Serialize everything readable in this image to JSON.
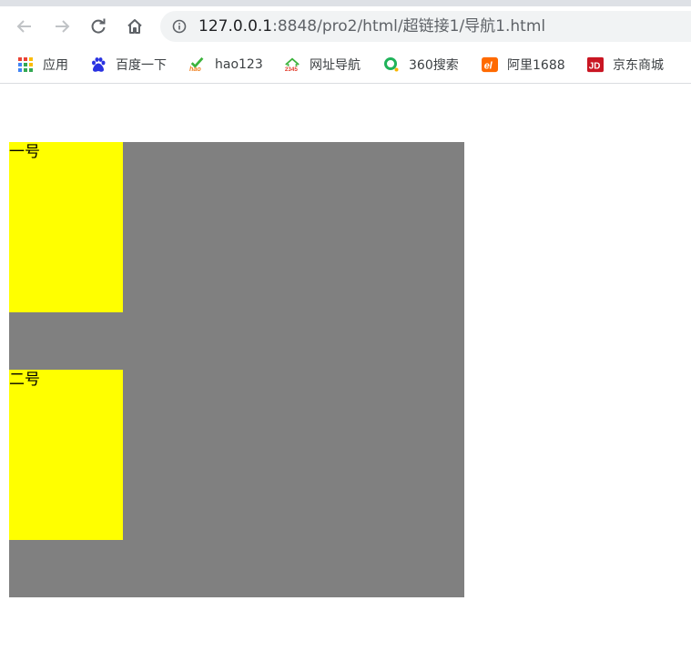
{
  "browser": {
    "url_host": "127.0.0.1",
    "url_rest": ":8848/pro2/html/超链接1/导航1.html"
  },
  "bookmarks": [
    {
      "label": "应用",
      "icon": "apps-grid-icon"
    },
    {
      "label": "百度一下",
      "icon": "baidu-paw-icon"
    },
    {
      "label": "hao123",
      "icon": "hao123-icon"
    },
    {
      "label": "网址导航",
      "icon": "2345-house-icon"
    },
    {
      "label": "360搜索",
      "icon": "360-search-icon"
    },
    {
      "label": "阿里1688",
      "icon": "1688-icon"
    },
    {
      "label": "京东商城",
      "icon": "jd-icon"
    }
  ],
  "page": {
    "items": [
      {
        "label": "一号"
      },
      {
        "label": "二号"
      }
    ]
  },
  "colors": {
    "container": "#808080",
    "item": "#ffff00"
  }
}
